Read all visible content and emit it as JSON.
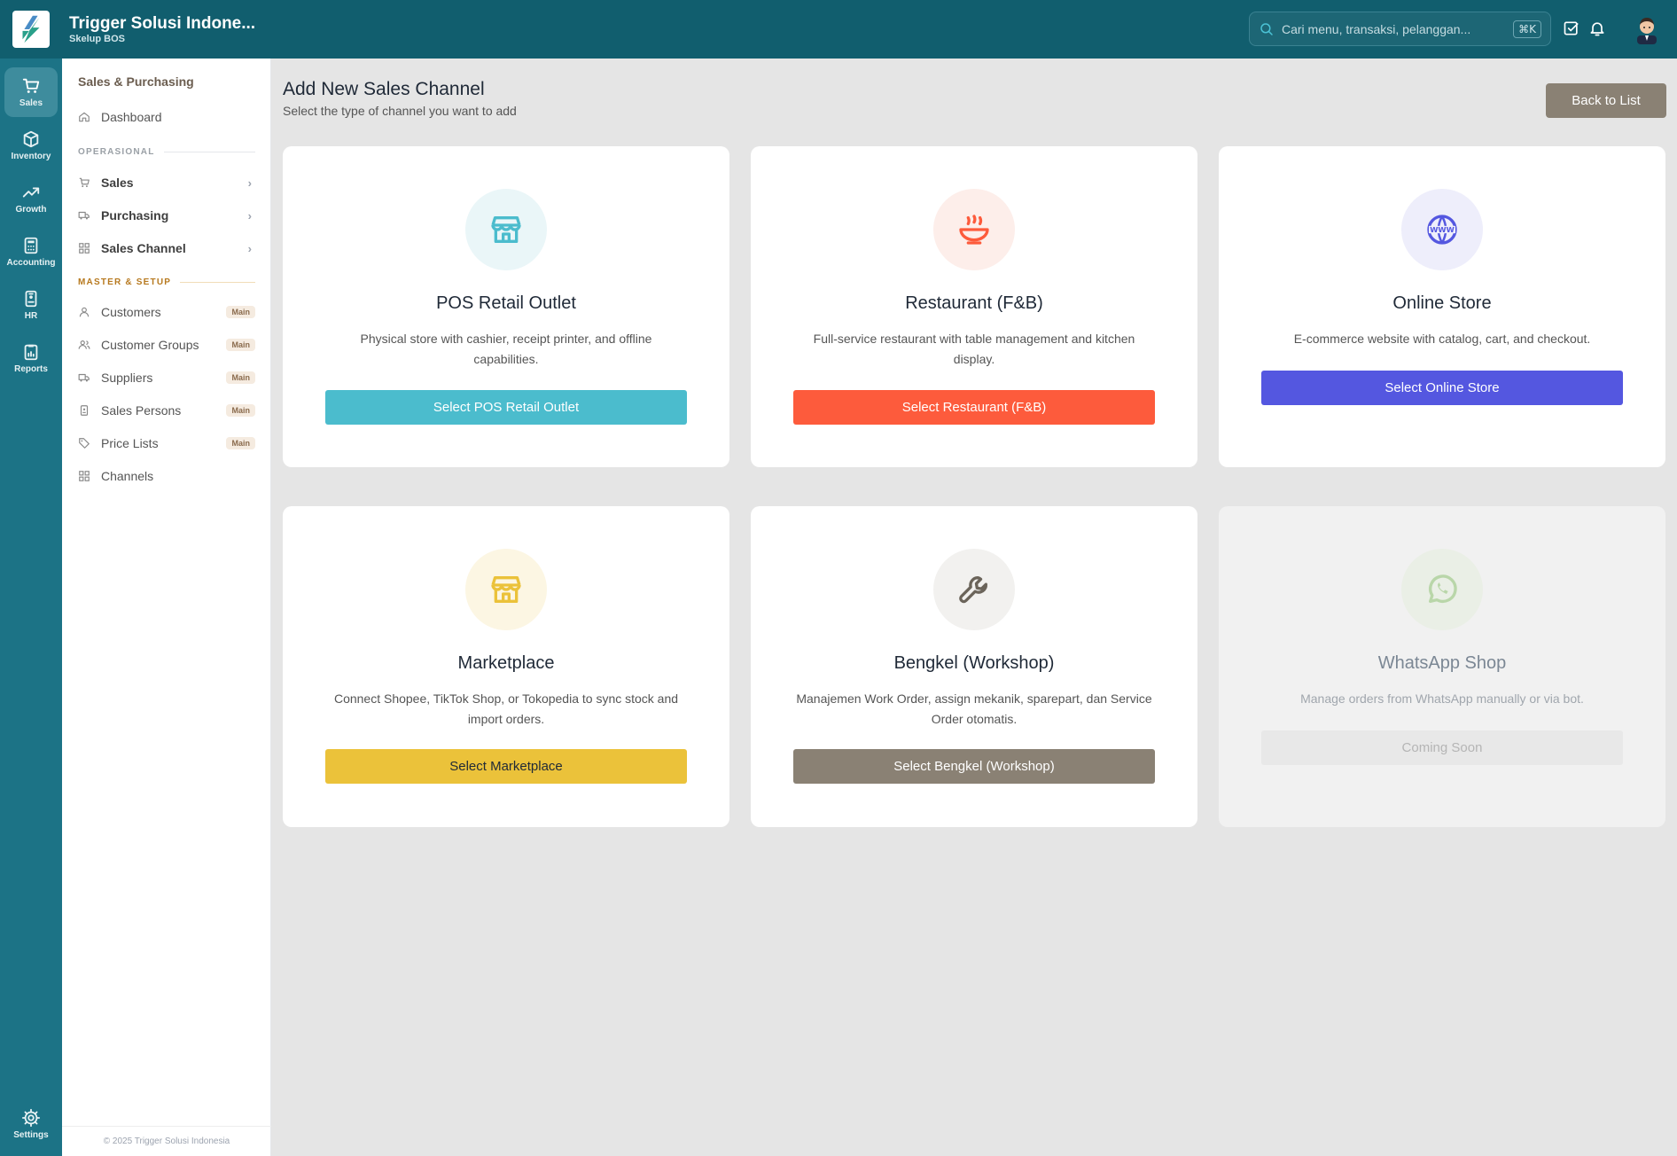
{
  "app": {
    "name": "Trigger Solusi Indone...",
    "subtitle": "Skelup BOS"
  },
  "search": {
    "placeholder": "Cari menu, transaksi, pelanggan...",
    "shortcut": "⌘K"
  },
  "rail": [
    {
      "label": "Sales",
      "icon": "cart-icon",
      "active": true
    },
    {
      "label": "Inventory",
      "icon": "box-icon"
    },
    {
      "label": "Growth",
      "icon": "trend-icon"
    },
    {
      "label": "Accounting",
      "icon": "calculator-icon"
    },
    {
      "label": "HR",
      "icon": "id-badge-icon"
    },
    {
      "label": "Reports",
      "icon": "report-icon"
    },
    {
      "label": "Settings",
      "icon": "gear-icon"
    }
  ],
  "sidenav": {
    "title": "Sales & Purchasing",
    "dashboard": "Dashboard",
    "section_operational": "OPERASIONAL",
    "operational": [
      "Sales",
      "Purchasing",
      "Sales Channel"
    ],
    "section_master": "MASTER & SETUP",
    "master": [
      {
        "label": "Customers",
        "badge": "Main"
      },
      {
        "label": "Customer Groups",
        "badge": "Main"
      },
      {
        "label": "Suppliers",
        "badge": "Main"
      },
      {
        "label": "Sales Persons",
        "badge": "Main"
      },
      {
        "label": "Price Lists",
        "badge": "Main"
      },
      {
        "label": "Channels"
      }
    ],
    "footer": "© 2025 Trigger Solusi Indonesia"
  },
  "page": {
    "title": "Add New Sales Channel",
    "subtitle": "Select the type of channel you want to add",
    "back_label": "Back to List"
  },
  "cards": [
    {
      "title": "POS Retail Outlet",
      "desc": "Physical store with cashier, receipt printer, and offline capabilities.",
      "button": "Select POS Retail Outlet",
      "color": "#4bbccd",
      "icon_bg": "#eaf6f8",
      "icon": "storefront-icon"
    },
    {
      "title": "Restaurant (F&B)",
      "desc": "Full-service restaurant with table management and kitchen display.",
      "button": "Select Restaurant (F&B)",
      "color": "#fd5b3c",
      "icon_bg": "#fdeeea",
      "icon": "soup-bowl-icon"
    },
    {
      "title": "Online Store",
      "desc": "E-commerce website with catalog, cart, and checkout.",
      "button": "Select Online Store",
      "color": "#5457e0",
      "icon_bg": "#eeeefb",
      "icon": "globe-www-icon"
    },
    {
      "title": "Marketplace",
      "desc": "Connect Shopee, TikTok Shop, or Tokopedia to sync stock and import orders.",
      "button": "Select Marketplace",
      "color": "#ebc23a",
      "icon_bg": "#fcf6e3",
      "icon": "storefront-icon"
    },
    {
      "title": "Bengkel (Workshop)",
      "desc": "Manajemen Work Order, assign mekanik, sparepart, dan Service Order otomatis.",
      "button": "Select Bengkel (Workshop)",
      "color": "#8a8174",
      "icon_bg": "#f2f1ef",
      "icon": "wrench-icon"
    },
    {
      "title": "WhatsApp Shop",
      "desc": "Manage orders from WhatsApp manually or via bot.",
      "button": "Coming Soon",
      "color": "#e8e8e8",
      "icon_bg": "#eaefe6",
      "icon": "whatsapp-icon",
      "disabled": true
    }
  ]
}
